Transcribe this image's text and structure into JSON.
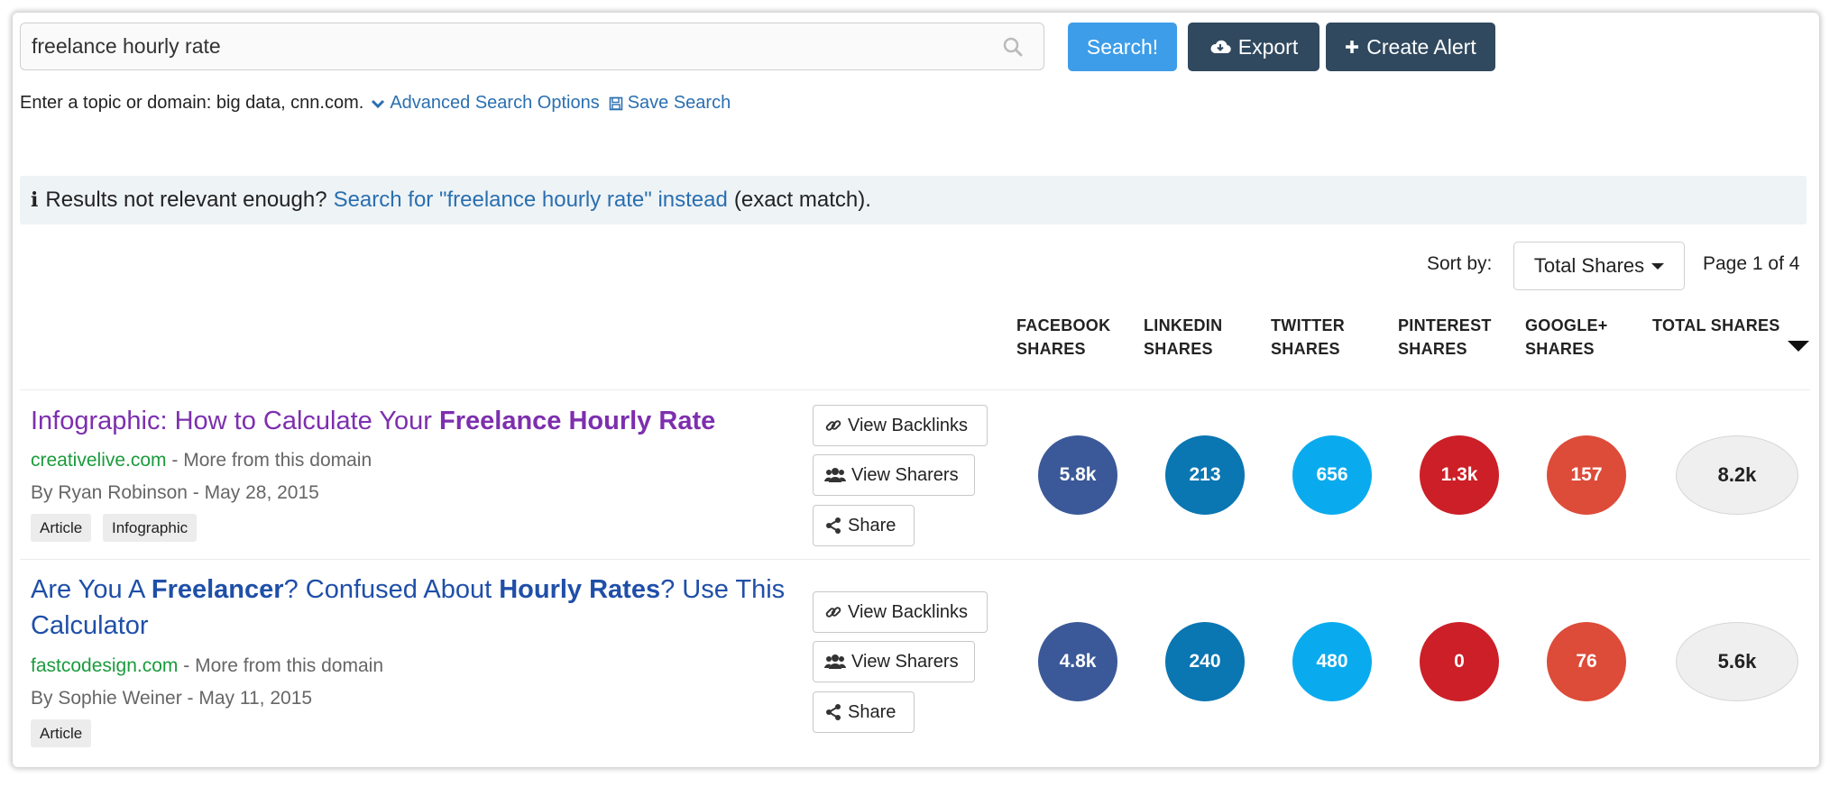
{
  "search": {
    "query": "freelance hourly rate",
    "search_label": "Search!",
    "export_label": "Export",
    "alert_label": "Create Alert"
  },
  "help": {
    "hint": "Enter a topic or domain: big data, cnn.com.",
    "advanced": "Advanced Search Options",
    "save": "Save Search"
  },
  "notice": {
    "prefix": "Results not relevant enough?",
    "link": "Search for \"freelance hourly rate\" instead",
    "suffix": "(exact match)."
  },
  "sort": {
    "label": "Sort by:",
    "selected": "Total Shares",
    "page": "Page 1 of 4"
  },
  "columns": {
    "facebook": [
      "FACEBOOK",
      "SHARES"
    ],
    "linkedin": [
      "LINKEDIN",
      "SHARES"
    ],
    "twitter": [
      "TWITTER",
      "SHARES"
    ],
    "pinterest": [
      "PINTEREST",
      "SHARES"
    ],
    "googleplus": [
      "GOOGLE+",
      "SHARES"
    ],
    "total": [
      "TOTAL SHARES"
    ]
  },
  "colors": {
    "facebook": "#3b5998",
    "linkedin": "#0a76b2",
    "twitter": "#0aabee",
    "pinterest": "#cc1f27",
    "googleplus": "#dd4b39"
  },
  "actions": {
    "backlinks": "View Backlinks",
    "sharers": "View Sharers",
    "share": "Share"
  },
  "results": [
    {
      "title_pre": "Infographic: How to Calculate Your ",
      "title_bold": "Freelance Hourly Rate",
      "domain": "creativelive.com",
      "more": "- More from this domain",
      "byline": "By Ryan Robinson - May 28, 2015",
      "tags": [
        "Article",
        "Infographic"
      ],
      "facebook": "5.8k",
      "linkedin": "213",
      "twitter": "656",
      "pinterest": "1.3k",
      "googleplus": "157",
      "total": "8.2k"
    },
    {
      "title_a": "Are You A ",
      "title_b": "Freelancer",
      "title_c": "? Confused About ",
      "title_d": "Hourly Rates",
      "title_e": "? Use This",
      "title_f": "Calculator",
      "domain": "fastcodesign.com",
      "more": "- More from this domain",
      "byline": "By Sophie Weiner - May 11, 2015",
      "tags": [
        "Article"
      ],
      "facebook": "4.8k",
      "linkedin": "240",
      "twitter": "480",
      "pinterest": "0",
      "googleplus": "76",
      "total": "5.6k"
    }
  ]
}
